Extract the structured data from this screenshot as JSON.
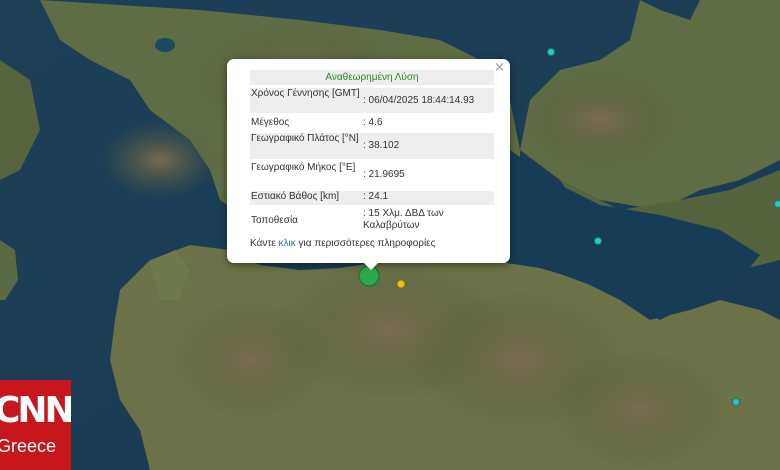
{
  "popup": {
    "title": "Αναθεωρημένη Λύση",
    "close_icon": "close-icon",
    "rows": [
      {
        "label": "Χρόνος Γέννησης [GMT]",
        "value": ": 06/04/2025 18:44:14.93"
      },
      {
        "label": "Μέγεθος",
        "value": ": 4.6"
      },
      {
        "label": "Γεωγραφικό Πλάτος [°N]",
        "value": ": 38.102"
      },
      {
        "label": "Γεωγραφικό Μήκος [°E]",
        "value": ": 21.9695"
      },
      {
        "label": "Εστιακό Βάθος [km]",
        "value": ": 24.1"
      },
      {
        "label": "Τοποθεσία",
        "value": ": 15 Χλμ. ΔΒΔ των Καλαβρύτων"
      }
    ],
    "more_prefix": "Κάντε",
    "more_link": "κλικ",
    "more_suffix": "για περισσότερες πληροφορίες"
  },
  "logo": {
    "line1": "CNN",
    "line2": "Greece"
  },
  "colors": {
    "main_marker": "#2ea84a",
    "secondary_marker": "#e8c020",
    "small_marker": "#2fc7c0",
    "logo_bg": "#c8161d",
    "popup_title": "#2a8a2a",
    "link": "#2a6fb0"
  }
}
